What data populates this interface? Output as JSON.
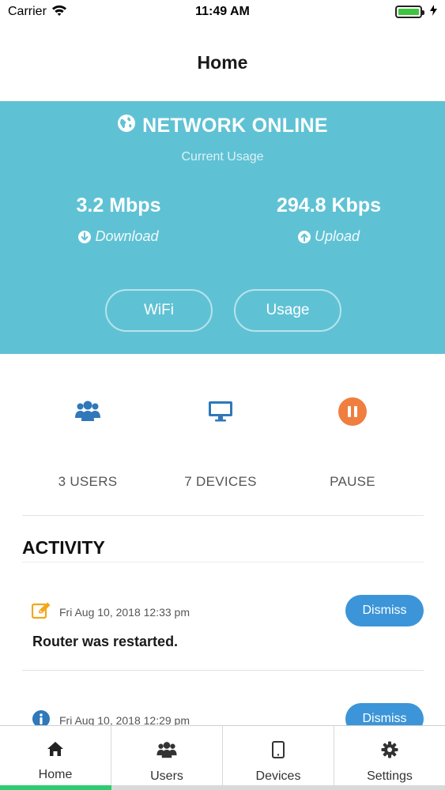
{
  "status_bar": {
    "carrier": "Carrier",
    "time": "11:49 AM",
    "battery_level": 1.0
  },
  "nav": {
    "title": "Home"
  },
  "hero": {
    "status": "NETWORK ONLINE",
    "subtitle": "Current Usage",
    "download": {
      "value": "3.2 Mbps",
      "label": "Download",
      "icon": "arrow-down-circle-icon"
    },
    "upload": {
      "value": "294.8 Kbps",
      "label": "Upload",
      "icon": "arrow-up-circle-icon"
    },
    "buttons": {
      "wifi": "WiFi",
      "usage": "Usage"
    },
    "color": "#5fc2d4"
  },
  "actions": [
    {
      "label": "3 USERS",
      "icon": "users-icon"
    },
    {
      "label": "7 DEVICES",
      "icon": "monitor-icon"
    },
    {
      "label": "PAUSE",
      "icon": "pause-icon"
    }
  ],
  "activity": {
    "heading": "ACTIVITY",
    "items": [
      {
        "icon": "edit-icon",
        "timestamp": "Fri Aug 10, 2018 12:33 pm",
        "text": "Router was restarted.",
        "dismiss": "Dismiss"
      },
      {
        "icon": "info-icon",
        "timestamp": "Fri Aug 10, 2018 12:29 pm",
        "dismiss": "Dismiss"
      }
    ]
  },
  "tabs": [
    {
      "label": "Home",
      "icon": "home-icon",
      "active": true
    },
    {
      "label": "Users",
      "icon": "users-icon",
      "active": false
    },
    {
      "label": "Devices",
      "icon": "tablet-icon",
      "active": false
    },
    {
      "label": "Settings",
      "icon": "gear-icon",
      "active": false
    }
  ],
  "colors": {
    "accent": "#3c95d8",
    "orange": "#f07e3f",
    "active_tab": "#2ecc71"
  }
}
